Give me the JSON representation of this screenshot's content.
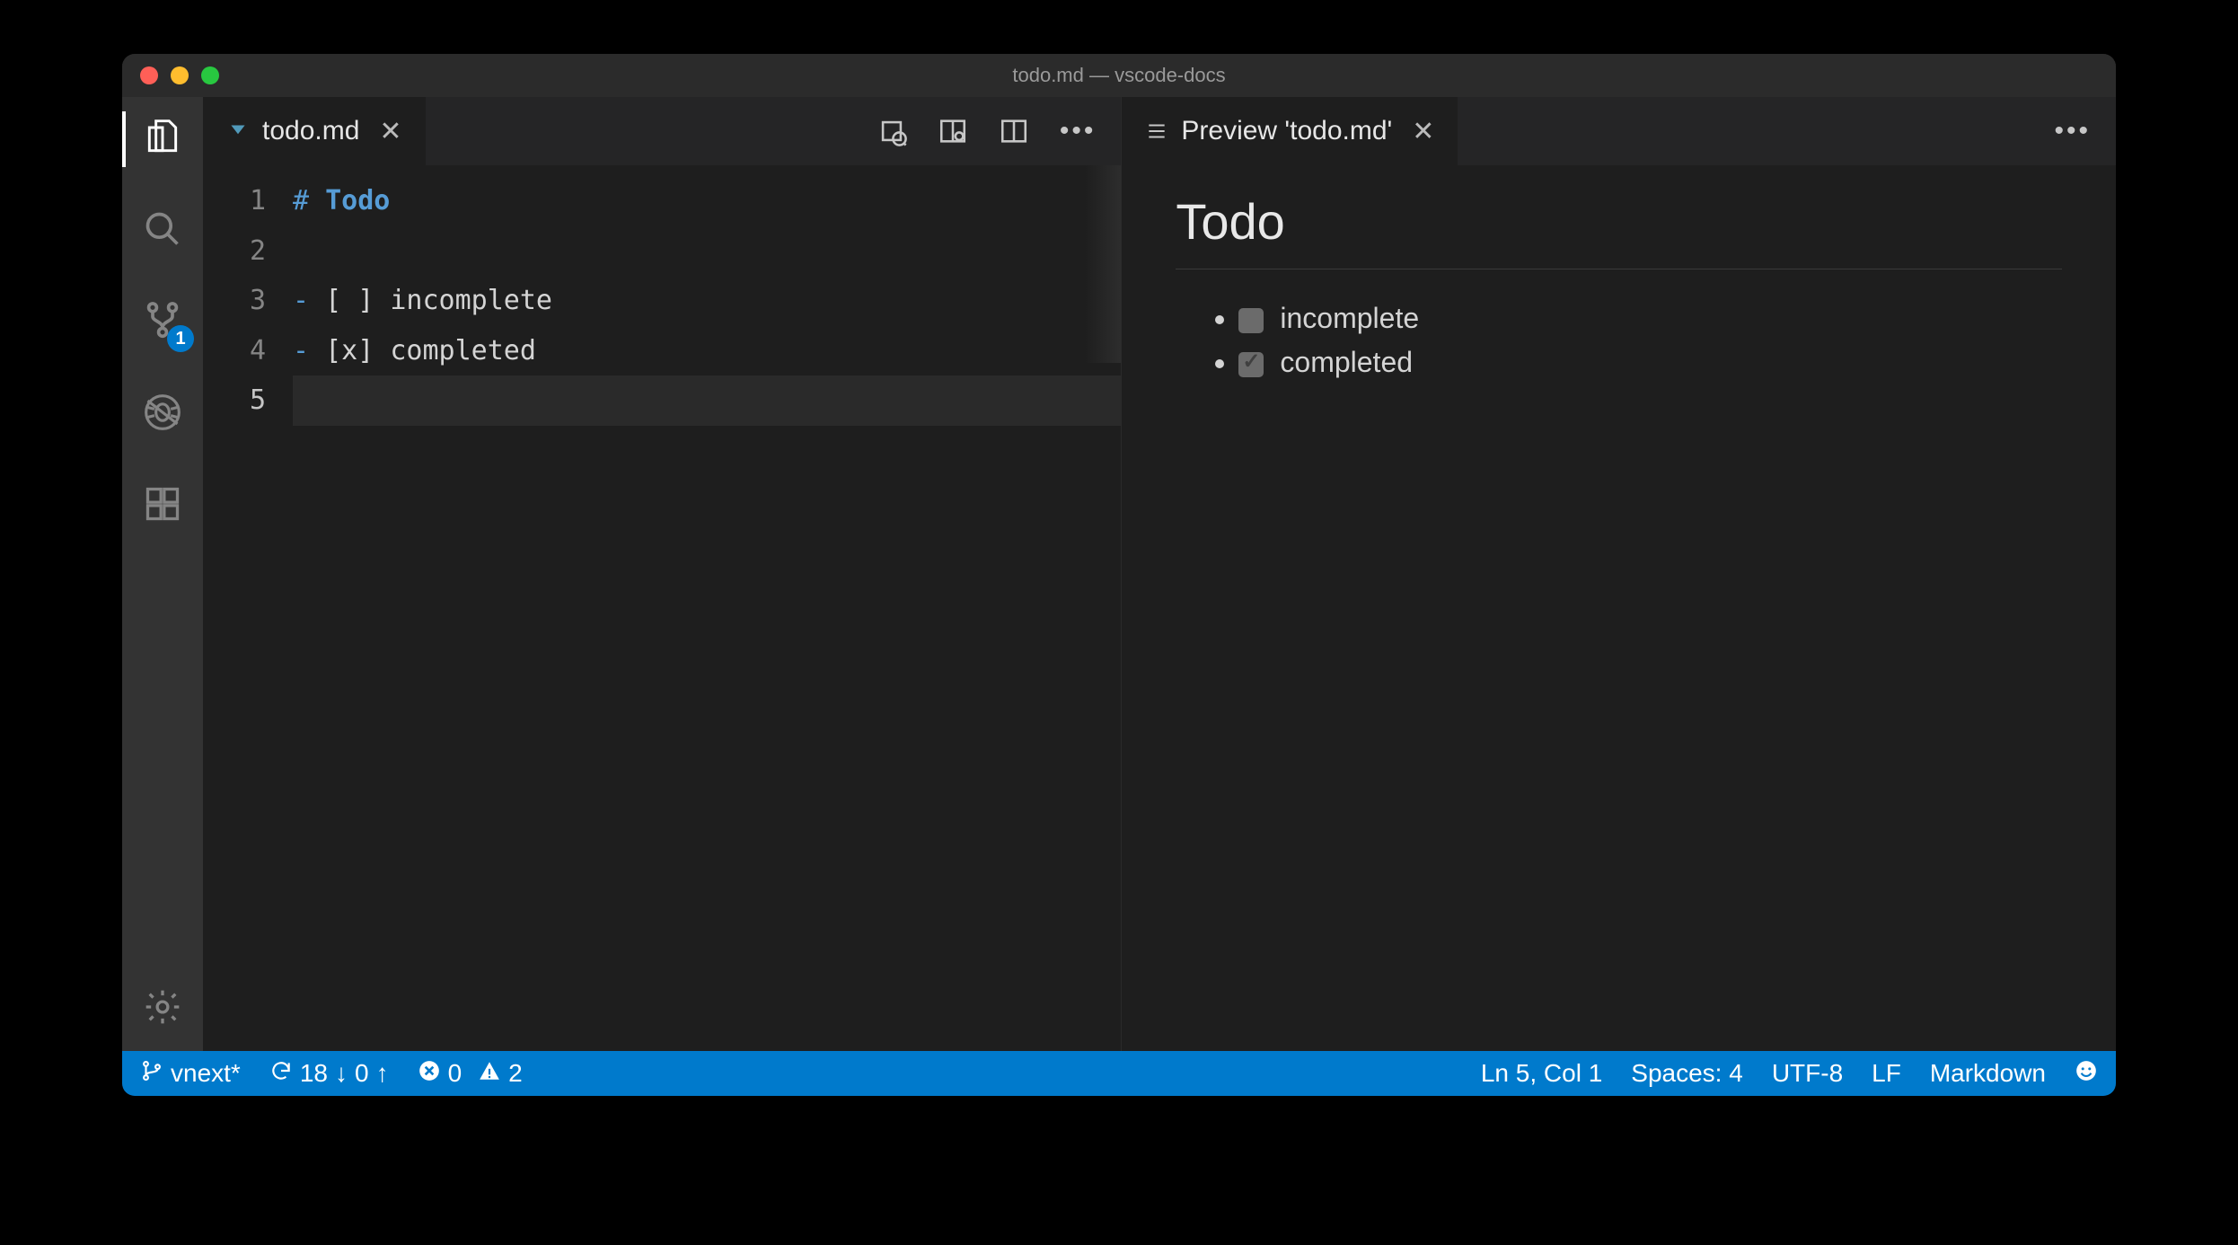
{
  "window": {
    "title": "todo.md — vscode-docs"
  },
  "activity": {
    "scm_badge": "1"
  },
  "tabs": {
    "editor": {
      "label": "todo.md"
    },
    "preview": {
      "label": "Preview 'todo.md'"
    }
  },
  "code": {
    "lines": [
      "1",
      "2",
      "3",
      "4",
      "5"
    ],
    "l1_hash": "#",
    "l1_head": " Todo",
    "l3_dash": "-",
    "l3_check": " [ ] ",
    "l3_text": "incomplete",
    "l4_dash": "-",
    "l4_check": " [x] ",
    "l4_text": "completed"
  },
  "preview": {
    "heading": "Todo",
    "items": [
      {
        "text": "incomplete",
        "checked": false
      },
      {
        "text": "completed",
        "checked": true
      }
    ]
  },
  "status": {
    "branch": "vnext*",
    "sync_in": "18",
    "sync_out": "0",
    "errors": "0",
    "warnings": "2",
    "cursor": "Ln 5, Col 1",
    "indent": "Spaces: 4",
    "encoding": "UTF-8",
    "eol": "LF",
    "language": "Markdown"
  }
}
